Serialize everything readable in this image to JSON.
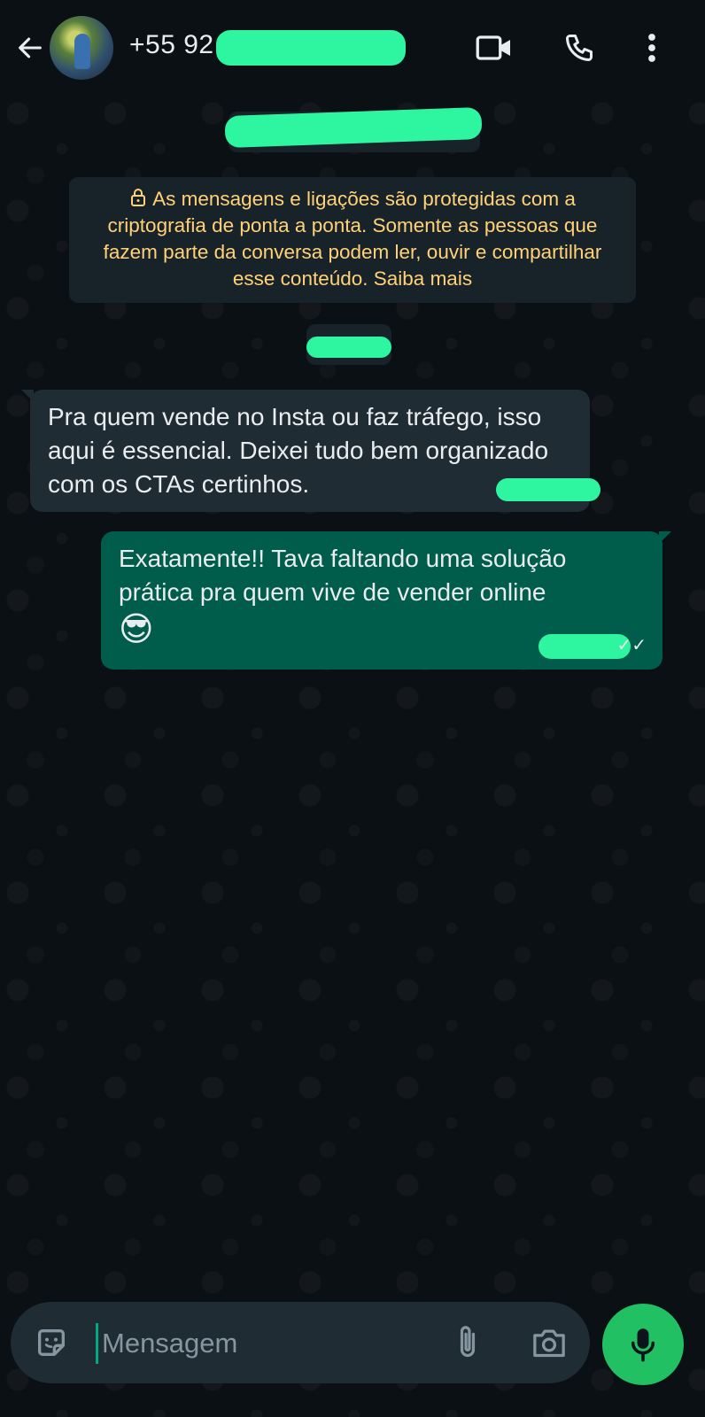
{
  "header": {
    "contact_name": "+55 92",
    "back_icon": "arrow-left-icon",
    "video_icon": "video-call-icon",
    "call_icon": "phone-icon",
    "menu_icon": "more-vertical-icon"
  },
  "encryption_notice": {
    "text": "As mensagens e ligações são protegidas com a criptografia de ponta a ponta. Somente as pessoas que fazem parte da conversa podem ler, ouvir e compartilhar esse conteúdo. Saiba mais"
  },
  "messages": [
    {
      "direction": "incoming",
      "text": "Pra quem vende no Insta ou faz tráfego, isso aqui é essencial. Deixei tudo bem organizado com os CTAs certinhos."
    },
    {
      "direction": "outgoing",
      "text": "Exatamente!! Tava faltando uma solução prática pra quem vive de vender online",
      "emoji": "😎",
      "status": "✓✓"
    }
  ],
  "composer": {
    "placeholder": "Mensagem",
    "sticker_icon": "sticker-icon",
    "attach_icon": "paperclip-icon",
    "camera_icon": "camera-icon",
    "mic_icon": "microphone-icon"
  },
  "colors": {
    "accent_green": "#21c063",
    "outgoing_bubble": "#005c4b",
    "incoming_bubble": "#202c33",
    "notice_text": "#ffd279"
  }
}
